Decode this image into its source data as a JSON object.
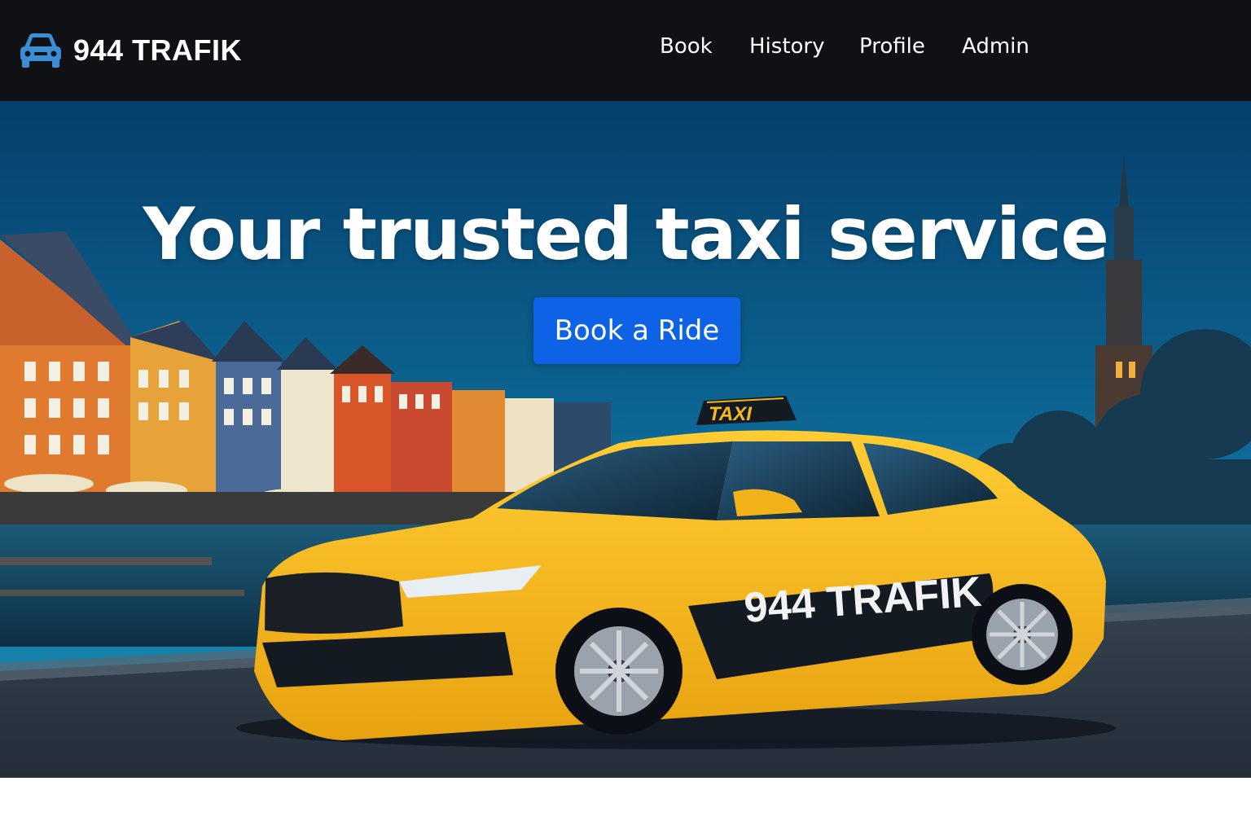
{
  "brand": {
    "name": "944 TRAFIK",
    "icon": "car-icon",
    "icon_color": "#3a8fd4"
  },
  "nav": {
    "links": [
      "Book",
      "History",
      "Profile",
      "Admin"
    ]
  },
  "hero": {
    "title": "Your trusted taxi service",
    "cta_label": "Book a Ride",
    "cta_color": "#0d62e6",
    "taxi_sign": "TAXI",
    "car_door_text": "944 TRAFIK"
  },
  "colors": {
    "navbar_bg": "#0f1115",
    "sky": "#0a4a78",
    "taxi_yellow": "#f5b820"
  }
}
